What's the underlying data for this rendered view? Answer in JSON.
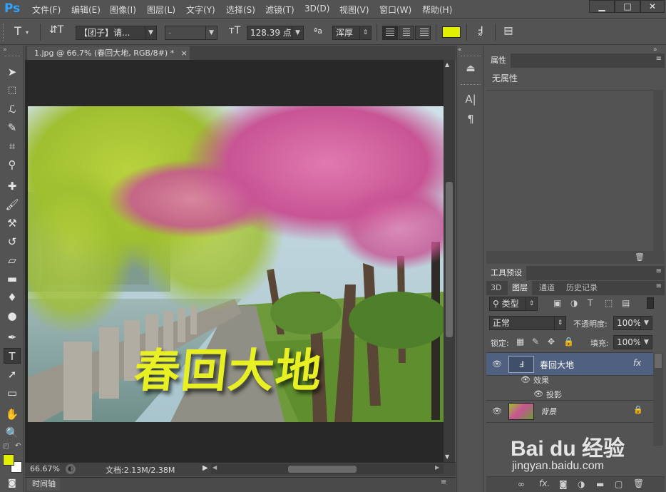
{
  "app": {
    "logo": "Ps",
    "menu": [
      "文件(F)",
      "编辑(E)",
      "图像(I)",
      "图层(L)",
      "文字(Y)",
      "选择(S)",
      "滤镜(T)",
      "3D(D)",
      "视图(V)",
      "窗口(W)",
      "帮助(H)"
    ],
    "window_buttons": [
      "minimize-icon",
      "maximize-icon",
      "close-icon"
    ]
  },
  "options": {
    "tool_icon": "T",
    "font_family": "【团子】请...",
    "font_style": "-",
    "font_size": "128.39 点",
    "aa_label": "ªa",
    "antialias": "浑厚",
    "text_color": "#e2f000"
  },
  "document": {
    "tab_title": "1.jpg @ 66.7% (春回大地, RGB/8#) *",
    "tab_close": "×",
    "canvas_text": "春回大地",
    "zoom": "66.67%",
    "doc_size": "文档:2.13M/2.38M",
    "timeline_label": "时间轴"
  },
  "panels": {
    "properties_tab": "属性",
    "properties_value": "无属性",
    "tool_presets_tab": "工具预设",
    "layer_tabs": [
      "3D",
      "图层",
      "通道",
      "历史记录"
    ],
    "filter_kind": "类型",
    "blend_mode": "正常",
    "opacity_label": "不透明度:",
    "opacity": "100%",
    "lock_label": "锁定:",
    "fill_label": "填充:",
    "fill": "100%",
    "layers": [
      {
        "name": "春回大地",
        "selected": true,
        "fx": "fx"
      },
      {
        "name": "背景",
        "selected": false
      }
    ],
    "effects_label": "效果",
    "effect_item": "投影"
  },
  "colors": {
    "foreground": "#e2f000",
    "background": "#ffffff",
    "text_fill": "#e8f024",
    "accent": "#4f6080"
  },
  "watermark": {
    "brand": "Bai du 经验",
    "url": "jingyan.baidu.com"
  }
}
